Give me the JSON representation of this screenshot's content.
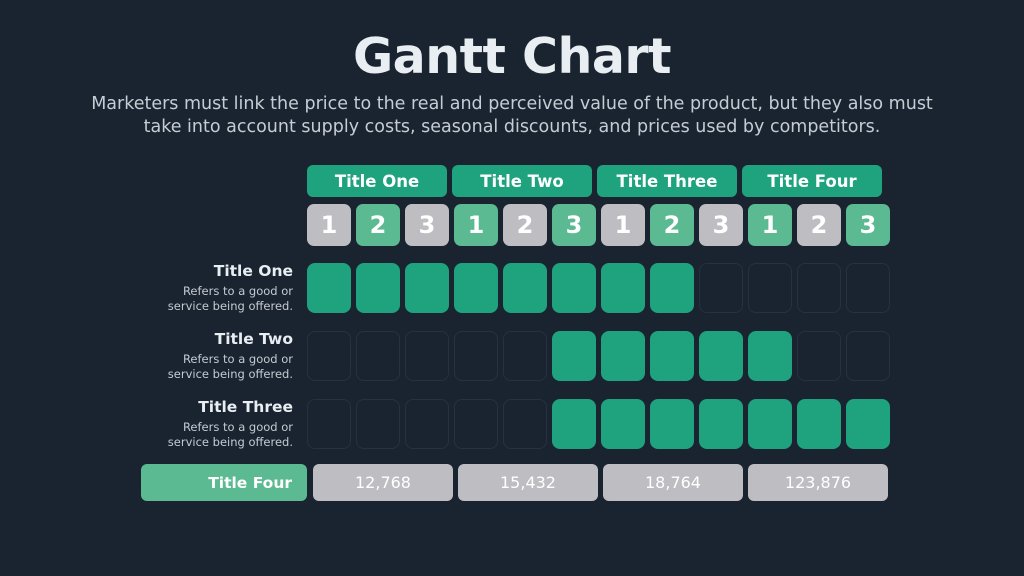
{
  "slide": {
    "title": "Gantt Chart",
    "subtitle": "Marketers must link the price to the real and perceived value of the product, but they also must take into account supply costs, seasonal discounts, and prices used by competitors.",
    "background_color": "#1a2430",
    "accent_color": "#1fa37f",
    "accent_light_color": "#5bba92",
    "neutral_color": "#bebec2"
  },
  "groups": [
    {
      "label": "Title One"
    },
    {
      "label": "Title Two"
    },
    {
      "label": "Title Three"
    },
    {
      "label": "Title Four"
    }
  ],
  "columns": [
    {
      "label": "1",
      "style": "gray"
    },
    {
      "label": "2",
      "style": "green"
    },
    {
      "label": "3",
      "style": "gray"
    },
    {
      "label": "1",
      "style": "green"
    },
    {
      "label": "2",
      "style": "gray"
    },
    {
      "label": "3",
      "style": "green"
    },
    {
      "label": "1",
      "style": "gray"
    },
    {
      "label": "2",
      "style": "green"
    },
    {
      "label": "3",
      "style": "gray"
    },
    {
      "label": "1",
      "style": "green"
    },
    {
      "label": "2",
      "style": "gray"
    },
    {
      "label": "3",
      "style": "green"
    }
  ],
  "rows": [
    {
      "title": "Title One",
      "description": "Refers to a good or service being offered.",
      "cells": [
        1,
        1,
        1,
        1,
        1,
        1,
        1,
        1,
        0,
        0,
        0,
        0
      ]
    },
    {
      "title": "Title Two",
      "description": "Refers to a good or service being offered.",
      "cells": [
        0,
        0,
        0,
        0,
        0,
        1,
        1,
        1,
        1,
        1,
        0,
        0
      ]
    },
    {
      "title": "Title Three",
      "description": "Refers to a good or service being offered.",
      "cells": [
        0,
        0,
        0,
        0,
        0,
        1,
        1,
        1,
        1,
        1,
        1,
        1
      ]
    }
  ],
  "totals": {
    "label": "Title Four",
    "values": [
      "12,768",
      "15,432",
      "18,764",
      "123,876"
    ]
  },
  "chart_data": {
    "type": "bar",
    "title": "Gantt Chart",
    "xlabel": "",
    "ylabel": "",
    "categories": [
      "Title One",
      "Title Two",
      "Title Three"
    ],
    "x": [
      "1",
      "2",
      "3",
      "1",
      "2",
      "3",
      "1",
      "2",
      "3",
      "1",
      "2",
      "3"
    ],
    "groups": [
      "Title One",
      "Title Two",
      "Title Three",
      "Title Four"
    ],
    "series": [
      {
        "name": "Title One",
        "values": [
          1,
          1,
          1,
          1,
          1,
          1,
          1,
          1,
          0,
          0,
          0,
          0
        ]
      },
      {
        "name": "Title Two",
        "values": [
          0,
          0,
          0,
          0,
          0,
          1,
          1,
          1,
          1,
          1,
          0,
          0
        ]
      },
      {
        "name": "Title Three",
        "values": [
          0,
          0,
          0,
          0,
          0,
          1,
          1,
          1,
          1,
          1,
          1,
          1
        ]
      }
    ],
    "totals": [
      12768,
      15432,
      18764,
      123876
    ],
    "grid": false,
    "legend": "none"
  }
}
